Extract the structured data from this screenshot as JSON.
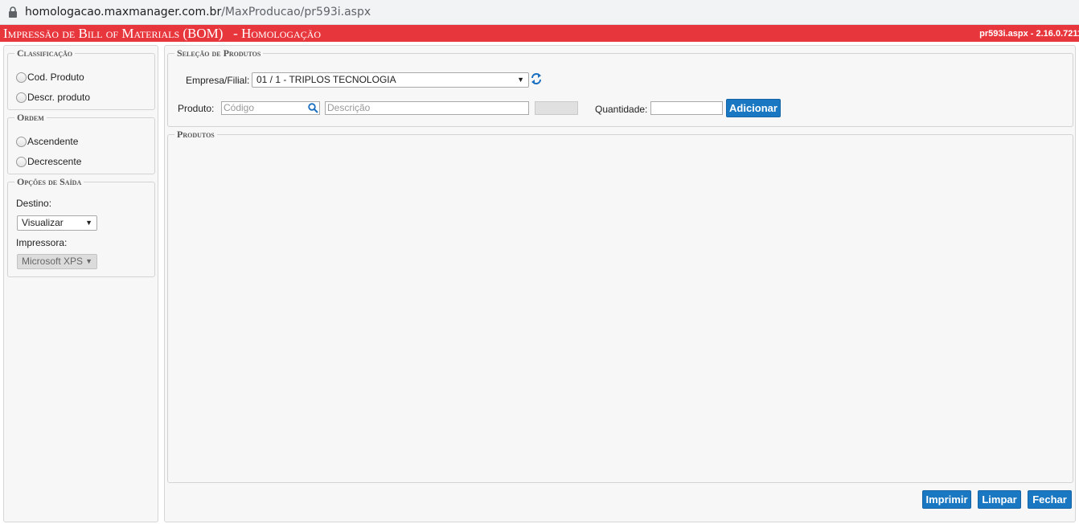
{
  "browser": {
    "url_host": "homologacao.maxmanager.com.br",
    "url_path": "/MaxProducao/pr593i.aspx"
  },
  "titlebar": {
    "title": "Impressão de Bill of Materials (BOM)   - Homologação",
    "version": "pr593i.aspx - 2.16.0.7211"
  },
  "classificacao": {
    "legend": "Classificação",
    "options": [
      "Cod. Produto",
      "Descr. produto"
    ]
  },
  "ordem": {
    "legend": "Ordem",
    "options": [
      "Ascendente",
      "Decrescente"
    ]
  },
  "opcoes_saida": {
    "legend": "Opções de Saída",
    "destino_label": "Destino:",
    "destino_value": "Visualizar",
    "impressora_label": "Impressora:",
    "impressora_value": "Microsoft XPS"
  },
  "selecao": {
    "legend": "Seleção de Produtos",
    "empresa_label": "Empresa/Filial:",
    "empresa_value": "01 / 1 - TRIPLOS TECNOLOGIA",
    "produto_label": "Produto:",
    "codigo_placeholder": "Código",
    "descricao_placeholder": "Descrição",
    "quantidade_label": "Quantidade:",
    "adicionar_label": "Adicionar"
  },
  "produtos": {
    "legend": "Produtos"
  },
  "actions": {
    "imprimir": "Imprimir",
    "limpar": "Limpar",
    "fechar": "Fechar"
  },
  "colors": {
    "titlebar": "#e8363d",
    "button": "#1a78c2"
  }
}
